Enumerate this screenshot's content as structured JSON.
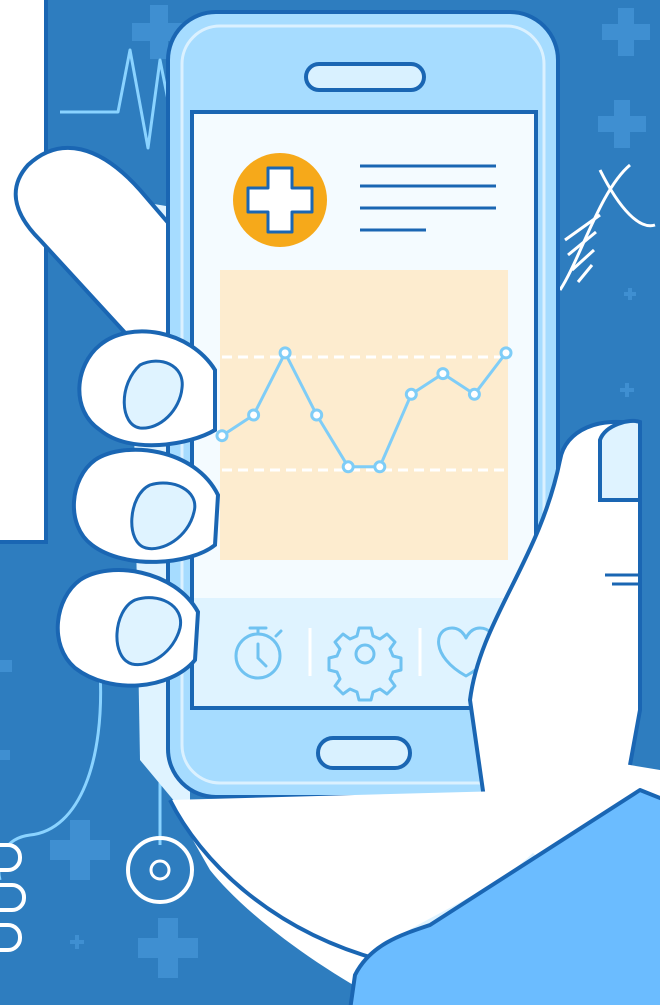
{
  "colors": {
    "background": "#2e7dbf",
    "background_light": "#3b8ccf",
    "panel": "#ffffff",
    "outline": "#1a66b3",
    "phone_body": "#a6dcff",
    "phone_inner": "#d9f1ff",
    "screen": "#f4fbff",
    "chart_bg": "#fdeccf",
    "chart_line": "#7fcdf7",
    "accent": "#f6a91a",
    "nav_bar": "#dff3ff",
    "nav_icon": "#6fc2f1",
    "skin": "#ffffff",
    "skin_shade": "#dff3ff",
    "sleeve": "#6bbcff"
  },
  "icons": {
    "medical": "medical-cross-icon",
    "menu": "text-lines-icon",
    "timer": "stopwatch-icon",
    "settings": "gear-icon",
    "favorite": "heart-icon",
    "dna": "dna-icon",
    "pulse": "heartbeat-icon",
    "stethoscope": "stethoscope-icon"
  },
  "chart_data": {
    "type": "line",
    "title": "",
    "xlabel": "",
    "ylabel": "",
    "series": [
      {
        "values": [
          6,
          7,
          10,
          7,
          4.5,
          4.5,
          8,
          9,
          8,
          10
        ]
      }
    ],
    "ylim": [
      0,
      14
    ],
    "grid": "dashed"
  }
}
